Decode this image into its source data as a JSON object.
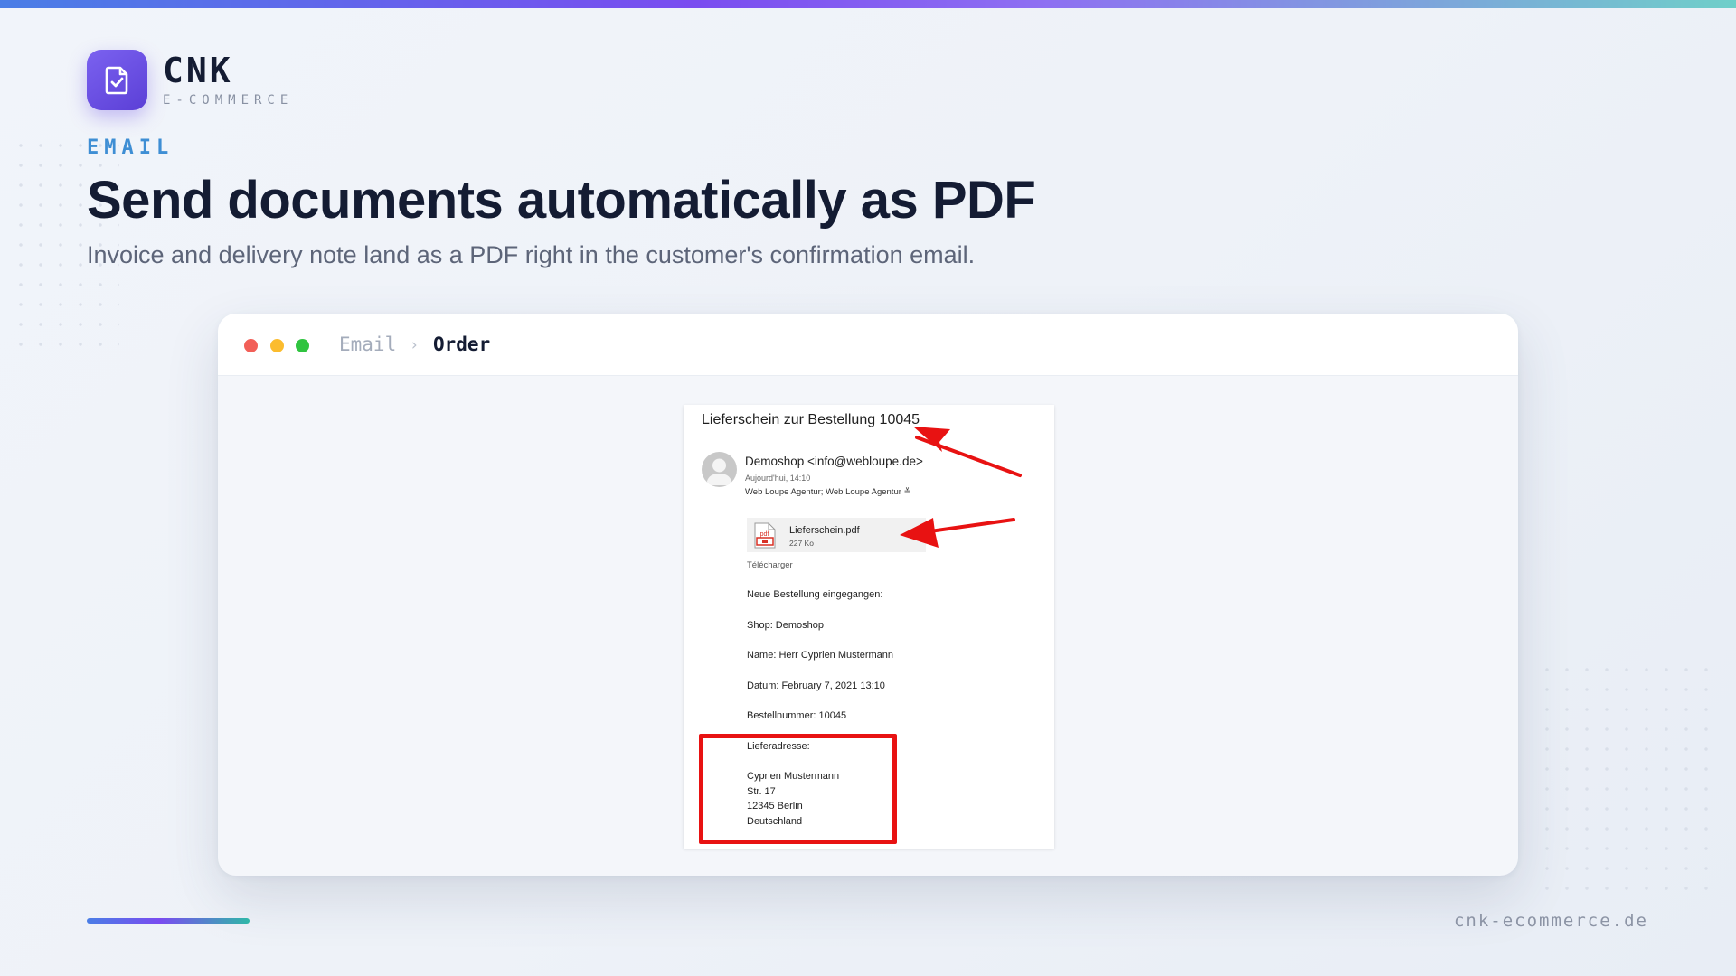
{
  "brand": {
    "name": "CNK",
    "tagline": "E-COMMERCE",
    "logo_icon": "document-check-icon",
    "accent_color": "#6a4ee6"
  },
  "hero": {
    "eyebrow": "EMAIL",
    "title": "Send documents automatically as PDF",
    "subtitle": "Invoice and delivery note land as a PDF right in the customer's confirmation email."
  },
  "window": {
    "breadcrumb": [
      "Email",
      "Order"
    ],
    "breadcrumb_separator": "›"
  },
  "email": {
    "subject": "Lieferschein zur Bestellung 10045",
    "sender": "Demoshop <info@webloupe.de>",
    "time": "Aujourd'hui, 14:10",
    "recipients": "Web Loupe Agentur; Web Loupe Agentur",
    "recipients_expand": "≚",
    "attachment": {
      "icon": "pdf-file-icon",
      "name": "Lieferschein.pdf",
      "size": "227 Ko",
      "icon_label": "pdf"
    },
    "download_label": "Télécharger",
    "body": [
      "Neue Bestellung eingegangen:",
      "Shop: Demoshop",
      "Name: Herr Cyprien Mustermann",
      "Datum: February 7, 2021 13:10",
      "Bestellnummer: 10045",
      "Lieferadresse:",
      "Cyprien Mustermann",
      "Str. 17",
      "12345 Berlin",
      "Deutschland"
    ],
    "highlight_color": "#e81212"
  },
  "footer": {
    "url": "cnk-ecommerce.de"
  }
}
